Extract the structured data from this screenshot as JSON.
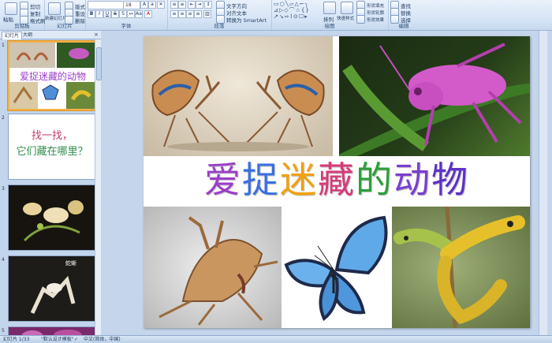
{
  "ribbon": {
    "clipboard": {
      "label": "剪贴板",
      "paste": "粘贴",
      "cut": "剪切",
      "copy": "复制",
      "format_painter": "格式刷"
    },
    "slides": {
      "label": "幻灯片",
      "new_slide": "新建幻灯片",
      "layout": "版式",
      "reset": "重设",
      "delete": "删除"
    },
    "font": {
      "label": "字体",
      "font_size": "18"
    },
    "paragraph": {
      "label": "段落",
      "text_direction": "文字方向",
      "align_text": "对齐文本",
      "convert_smartart": "转换为 SmartArt"
    },
    "drawing": {
      "label": "绘图",
      "arrange": "排列",
      "quick_styles": "快速样式",
      "shape_fill": "形状填充",
      "shape_outline": "形状轮廓",
      "shape_effects": "形状效果"
    },
    "editing": {
      "label": "编辑",
      "find": "查找",
      "replace": "替换",
      "select": "选择"
    }
  },
  "panel": {
    "tab_slides": "幻灯片",
    "tab_outline": "大纲",
    "close": "×"
  },
  "thumbnails": [
    {
      "number": "1",
      "title": "爱捉迷藏的动物"
    },
    {
      "number": "2",
      "line1": "找一找，",
      "line2": "它们藏在哪里？"
    },
    {
      "number": "3",
      "caption": ""
    },
    {
      "number": "4",
      "caption": "蛇蜥"
    },
    {
      "number": "5"
    }
  ],
  "slide": {
    "title_chars": [
      "爱",
      "捉",
      "迷",
      "藏",
      "的",
      "动",
      "物"
    ],
    "title_colors": [
      "#9b3ec8",
      "#3a6fe0",
      "#f0a010",
      "#d63a7a",
      "#2d9e3a",
      "#7a3fd0",
      "#5e30c8"
    ]
  },
  "status": {
    "slide_info": "幻灯片 1/33",
    "theme": "\"默认设计模板\"",
    "language": "中文(简体，中国)"
  },
  "colors": {
    "ribbon_bg": "#d4e3f5",
    "workspace_bg": "#c5d6ec",
    "selected_border": "#f2b24a"
  }
}
